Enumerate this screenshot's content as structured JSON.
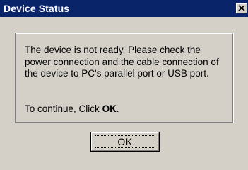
{
  "window": {
    "title": "Device Status",
    "title_bar_color": "#0a246a",
    "background_color": "#d4d0c8",
    "close_icon": "close-icon"
  },
  "message": {
    "text": "The device is not ready. Please check the power connection and the cable connection of the device to PC's parallel port  or USB port.",
    "continue_prefix": "To continue, Click ",
    "continue_bold": "OK",
    "continue_suffix": "."
  },
  "buttons": {
    "ok_label": "OK"
  }
}
